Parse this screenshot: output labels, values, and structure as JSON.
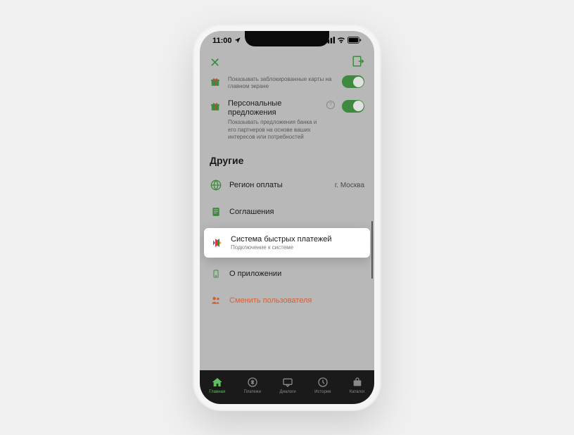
{
  "status": {
    "time": "11:00"
  },
  "settings": {
    "blocked_cards": {
      "title": "Показывать заблокированные карты на главном экране"
    },
    "personal_offers": {
      "title": "Персональные предложения",
      "desc": "Показывать предложения банка и его партнеров на основе ваших интересов или потребностей"
    }
  },
  "section_other": "Другие",
  "items": {
    "region": {
      "title": "Регион оплаты",
      "value": "г. Москва"
    },
    "agreements": {
      "title": "Соглашения"
    },
    "sbp": {
      "title": "Система быстрых платежей",
      "sub": "Подключение к системе"
    },
    "about": {
      "title": "О приложении"
    },
    "switch_user": {
      "title": "Сменить пользователя"
    }
  },
  "tabs": {
    "home": "Главная",
    "payments": "Платежи",
    "dialogs": "Диалоги",
    "history": "История",
    "catalog": "Каталог"
  }
}
